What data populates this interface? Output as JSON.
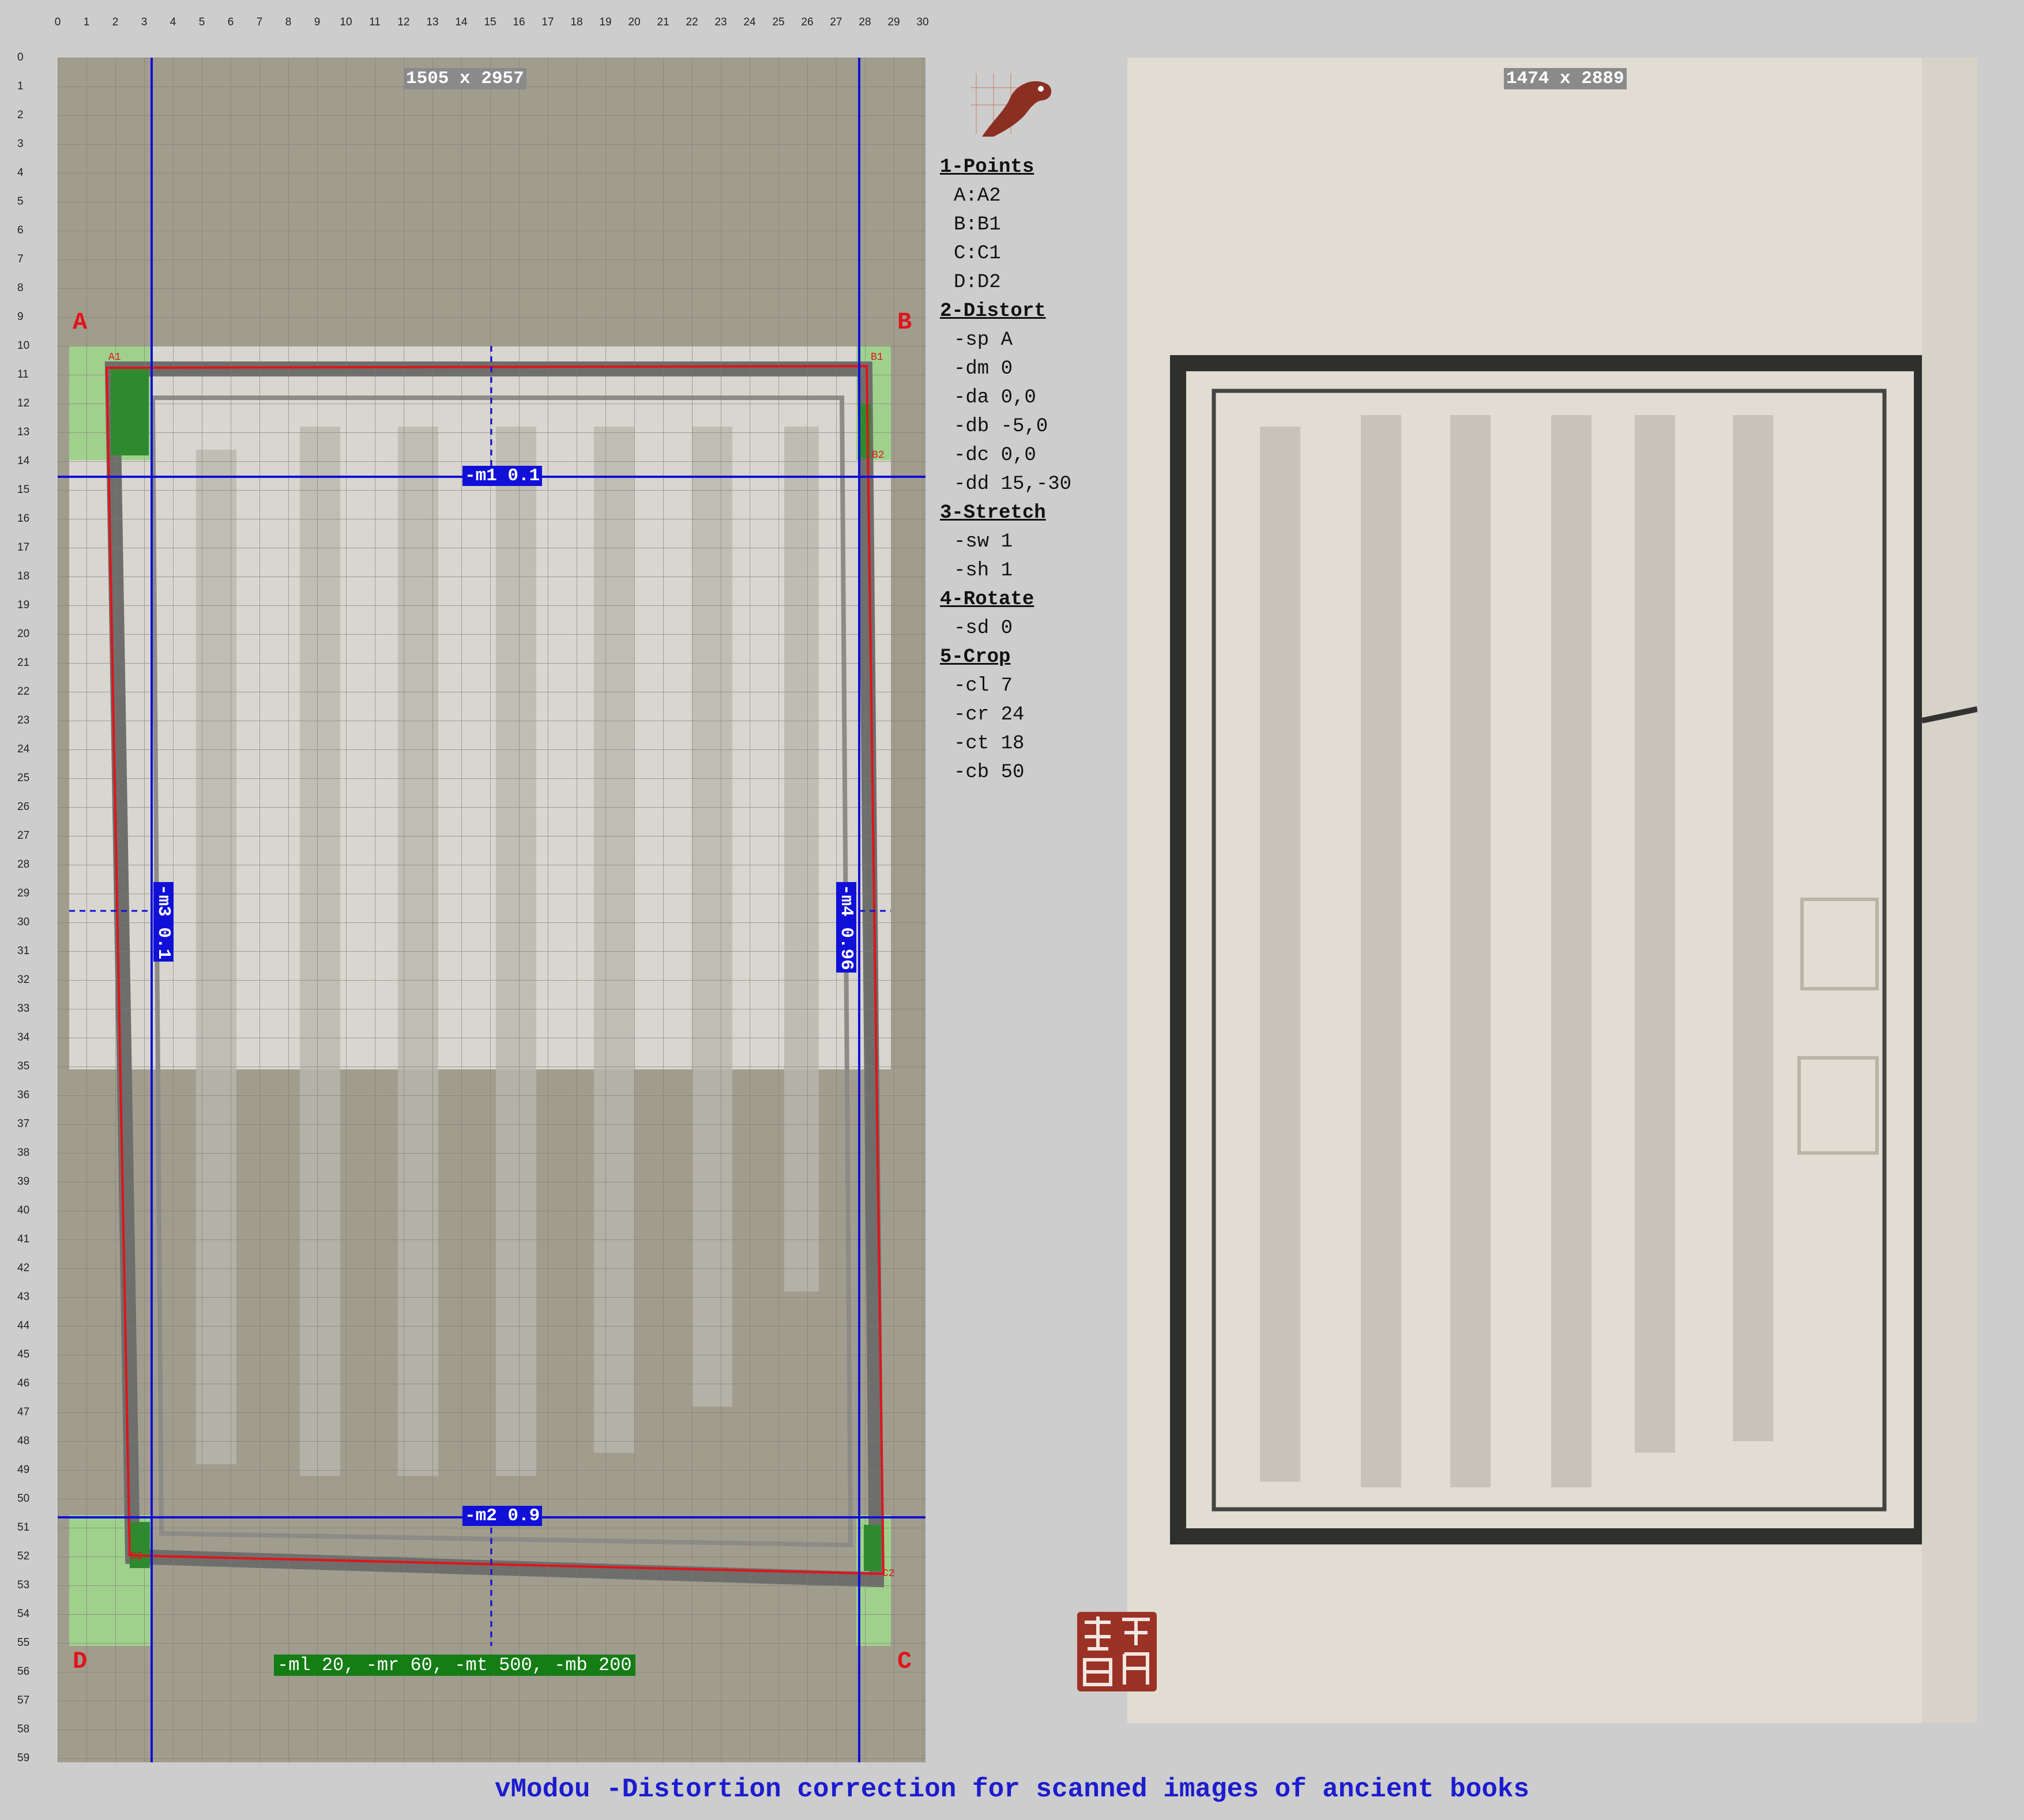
{
  "ruler": {
    "top_ticks": [
      "0",
      "1",
      "2",
      "3",
      "4",
      "5",
      "6",
      "7",
      "8",
      "9",
      "10",
      "11",
      "12",
      "13",
      "14",
      "15",
      "16",
      "17",
      "18",
      "19",
      "20",
      "21",
      "22",
      "23",
      "24",
      "25",
      "26",
      "27",
      "28",
      "29",
      "30"
    ],
    "left_ticks": [
      "0",
      "1",
      "2",
      "3",
      "4",
      "5",
      "6",
      "7",
      "8",
      "9",
      "10",
      "11",
      "12",
      "13",
      "14",
      "15",
      "16",
      "17",
      "18",
      "19",
      "20",
      "21",
      "22",
      "23",
      "24",
      "25",
      "26",
      "27",
      "28",
      "29",
      "30",
      "31",
      "32",
      "33",
      "34",
      "35",
      "36",
      "37",
      "38",
      "39",
      "40",
      "41",
      "42",
      "43",
      "44",
      "45",
      "46",
      "47",
      "48",
      "49",
      "50",
      "51",
      "52",
      "53",
      "54",
      "55",
      "56",
      "57",
      "58",
      "59"
    ]
  },
  "left_image": {
    "dimensions": "1505 x 2957",
    "corners": {
      "a": "A",
      "b": "B",
      "c": "C",
      "d": "D"
    },
    "point_labels": {
      "a1": "A1",
      "b1": "B1",
      "b2": "B2",
      "d2": "D2",
      "c2": "C2"
    },
    "m1": "-m1 0.1",
    "m2": "-m2 0.9",
    "m3": "-m3 0.1",
    "m4": "-m4 0.96",
    "margins": "-ml 20, -mr 60, -mt 500, -mb 200"
  },
  "params": {
    "points_head": "1-Points",
    "points": [
      "A:A2",
      "B:B1",
      "C:C1",
      "D:D2"
    ],
    "distort_head": "2-Distort",
    "distort": [
      "-sp A",
      "-dm 0",
      "-da 0,0",
      "-db -5,0",
      "-dc 0,0",
      "-dd 15,-30"
    ],
    "stretch_head": "3-Stretch",
    "stretch": [
      "-sw 1",
      "-sh 1"
    ],
    "rotate_head": "4-Rotate",
    "rotate": [
      "-sd 0"
    ],
    "crop_head": "5-Crop",
    "crop": [
      "-cl 7",
      "-cr 24",
      "-ct 18",
      "-cb 50"
    ]
  },
  "right_image": {
    "dimensions": "1474 x 2889"
  },
  "footer": "vModou -Distortion correction for scanned images of ancient books",
  "colors": {
    "grid_blue": "#1010d8",
    "distort_red": "#e0141b",
    "margin_green": "#147d14",
    "page_paper": "#d9d6cf"
  }
}
